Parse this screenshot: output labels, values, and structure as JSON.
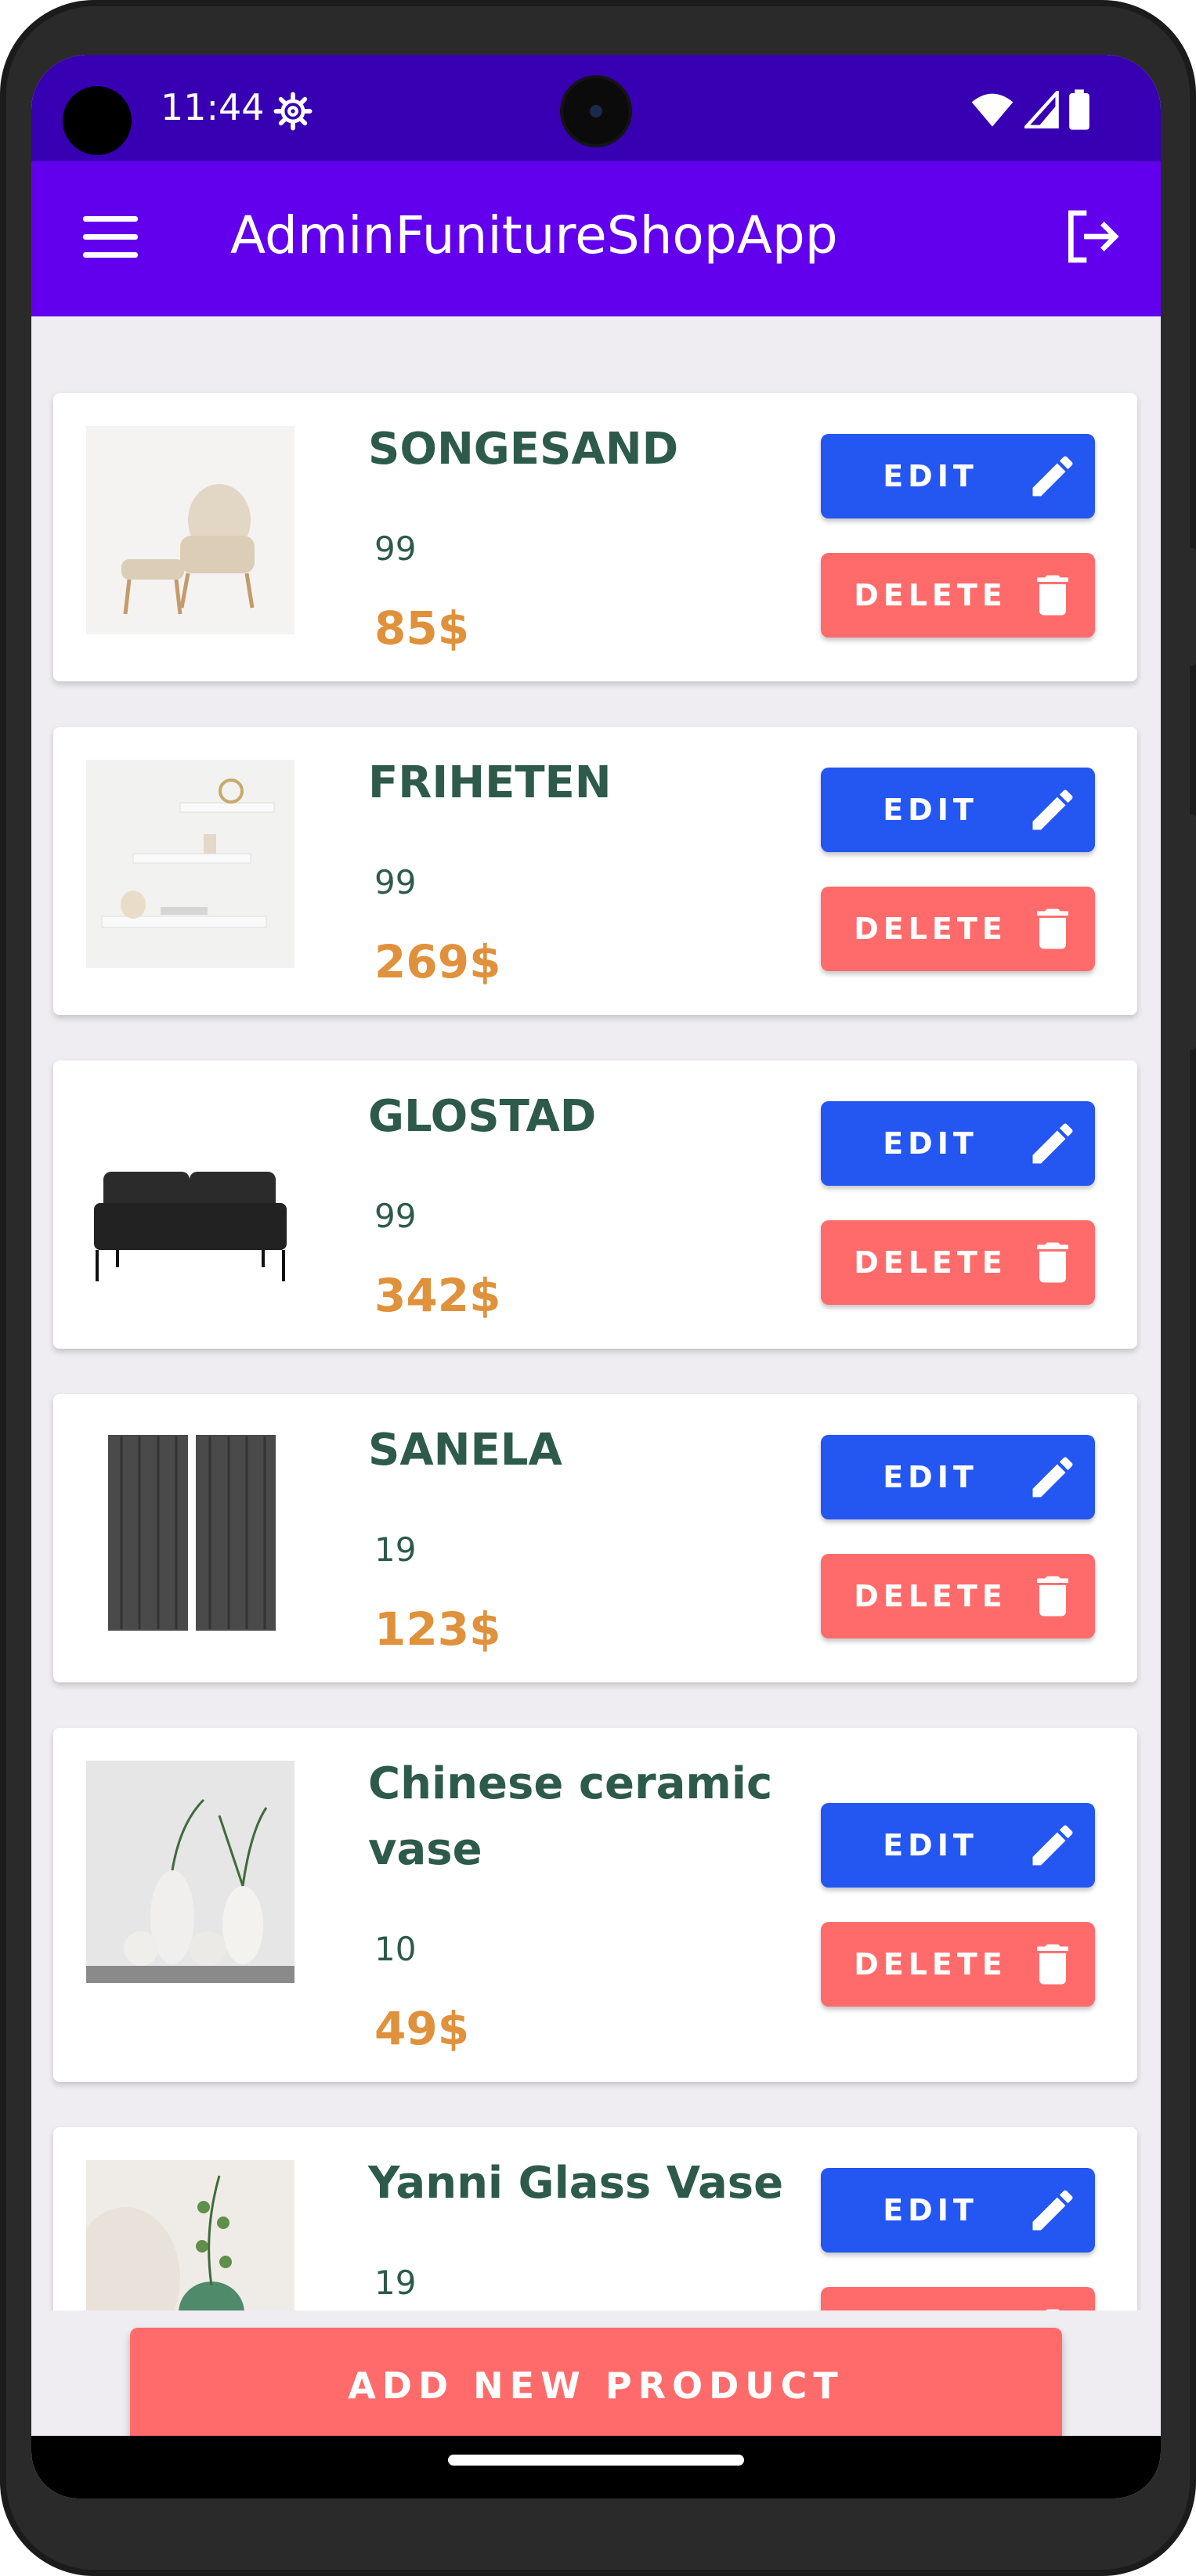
{
  "statusbar": {
    "time": "11:44"
  },
  "appbar": {
    "title": "AdminFunitureShopApp"
  },
  "products": [
    {
      "name": "SONGESAND",
      "quantity": "99",
      "price": "85$"
    },
    {
      "name": "FRIHETEN",
      "quantity": "99",
      "price": "269$"
    },
    {
      "name": "GLOSTAD",
      "quantity": "99",
      "price": "342$"
    },
    {
      "name": "SANELA",
      "quantity": "19",
      "price": "123$"
    },
    {
      "name": "Chinese ceramic vase",
      "quantity": "10",
      "price": "49$"
    },
    {
      "name": "Yanni Glass Vase",
      "quantity": "19",
      "price": ""
    }
  ],
  "buttons": {
    "edit_label": "EDIT",
    "delete_label": "DELETE",
    "add_label": "ADD NEW PRODUCT"
  },
  "colors": {
    "statusbar": "#3700b3",
    "appbar": "#6200ee",
    "edit": "#2456f2",
    "delete": "#ff6b6b",
    "name_text": "#2d5a4a",
    "price_text": "#e0913b",
    "background": "#efedf1"
  },
  "icons": {
    "menu": "menu-icon",
    "logout": "logout-icon",
    "edit": "pencil-icon",
    "delete": "trash-icon",
    "settings": "gear-icon",
    "wifi": "wifi-icon",
    "signal": "signal-icon",
    "battery": "battery-icon"
  }
}
